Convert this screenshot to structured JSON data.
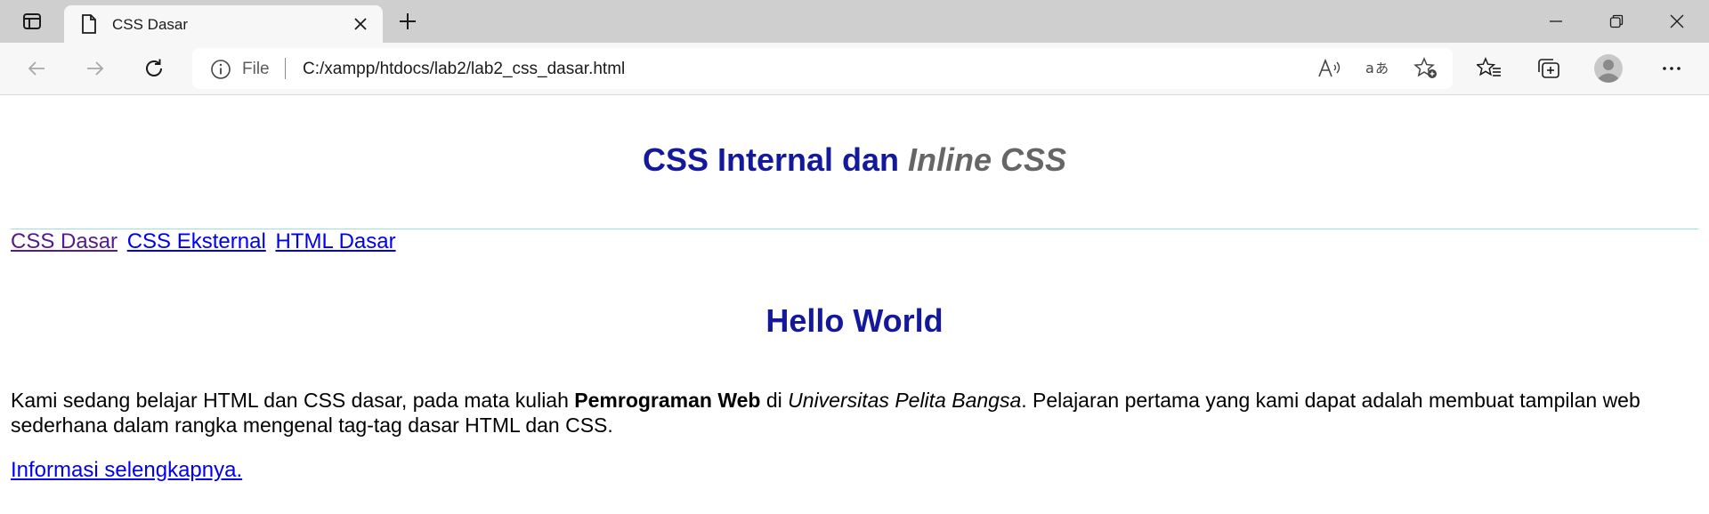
{
  "browser": {
    "tab_title": "CSS Dasar",
    "address_scheme": "File",
    "address_url": "C:/xampp/htdocs/lab2/lab2_css_dasar.html",
    "icons": [
      "tab-actions-icon",
      "page-icon",
      "close-icon",
      "plus-icon",
      "minimize-icon",
      "restore-icon",
      "window-close-icon",
      "back-arrow-icon",
      "forward-arrow-icon",
      "refresh-icon",
      "info-icon",
      "read-aloud-icon",
      "translate-icon",
      "add-favorite-icon",
      "favorites-icon",
      "collections-icon",
      "profile-icon",
      "more-icon"
    ]
  },
  "page": {
    "heading_main": "CSS Internal dan ",
    "heading_italic": "Inline CSS",
    "nav": [
      "CSS Dasar",
      "CSS Eksternal",
      "HTML Dasar"
    ],
    "hello": "Hello World",
    "paragraph": {
      "part1": "Kami sedang belajar HTML dan CSS dasar, pada mata kuliah ",
      "bold": "Pemrograman Web",
      "part2": " di ",
      "italic": "Universitas Pelita Bangsa",
      "part3": ". Pelajaran pertama yang kami dapat adalah membuat tampilan web sederhana dalam rangka mengenal tag-tag dasar HTML dan CSS."
    },
    "more_link": "Informasi selengkapnya."
  },
  "colors": {
    "heading": "#13199a",
    "italic_heading": "#666666",
    "link": "#0000ee",
    "visited_link": "#551a8b",
    "hr": "#9adfe6"
  }
}
